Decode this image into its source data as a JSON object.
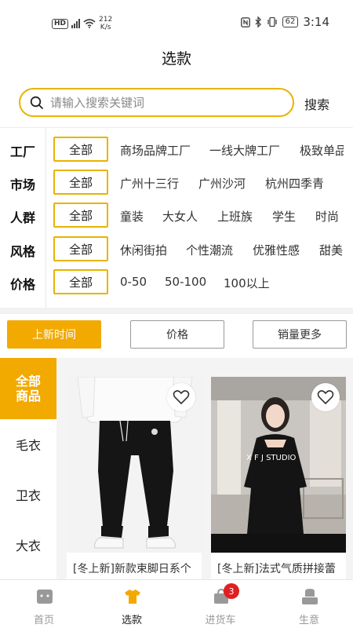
{
  "status_bar": {
    "hd": "HD",
    "network_speed_value": "212",
    "network_speed_unit": "K/s",
    "battery": "62",
    "time": "3:14"
  },
  "header": {
    "title": "选款"
  },
  "search": {
    "placeholder": "请输入搜索关键词",
    "button_label": "搜索"
  },
  "filters": [
    {
      "label": "工厂",
      "all": "全部",
      "options": [
        "商场品牌工厂",
        "一线大牌工厂",
        "极致单品"
      ]
    },
    {
      "label": "市场",
      "all": "全部",
      "options": [
        "广州十三行",
        "广州沙河",
        "杭州四季青"
      ]
    },
    {
      "label": "人群",
      "all": "全部",
      "options": [
        "童装",
        "大女人",
        "上班族",
        "学生",
        "时尚"
      ]
    },
    {
      "label": "风格",
      "all": "全部",
      "options": [
        "休闲街拍",
        "个性潮流",
        "优雅性感",
        "甜美"
      ]
    },
    {
      "label": "价格",
      "all": "全部",
      "options": [
        "0-50",
        "50-100",
        "100以上"
      ]
    }
  ],
  "sort": {
    "items": [
      {
        "label": "上新时间",
        "active": true
      },
      {
        "label": "价格",
        "active": false
      },
      {
        "label": "销量更多",
        "active": false
      }
    ]
  },
  "categories": [
    {
      "label_line1": "全部",
      "label_line2": "商品",
      "active": true
    },
    {
      "label": "毛衣"
    },
    {
      "label": "卫衣"
    },
    {
      "label": "大衣"
    }
  ],
  "products": [
    {
      "title": "[冬上新]新款束脚日系个",
      "image": "black-jogger-pants"
    },
    {
      "title": "[冬上新]法式气质拼接蕾",
      "image": "black-dress-model",
      "image_text": "X F J     STUDIO"
    }
  ],
  "tabbar": {
    "items": [
      {
        "label": "首页",
        "icon": "home-icon"
      },
      {
        "label": "选款",
        "icon": "tshirt-icon",
        "active": true
      },
      {
        "label": "进货车",
        "icon": "bag-icon",
        "badge": "3"
      },
      {
        "label": "生意",
        "icon": "business-icon"
      }
    ]
  },
  "colors": {
    "accent": "#f2a900",
    "accent_border": "#e8b400",
    "badge": "#e02020"
  }
}
